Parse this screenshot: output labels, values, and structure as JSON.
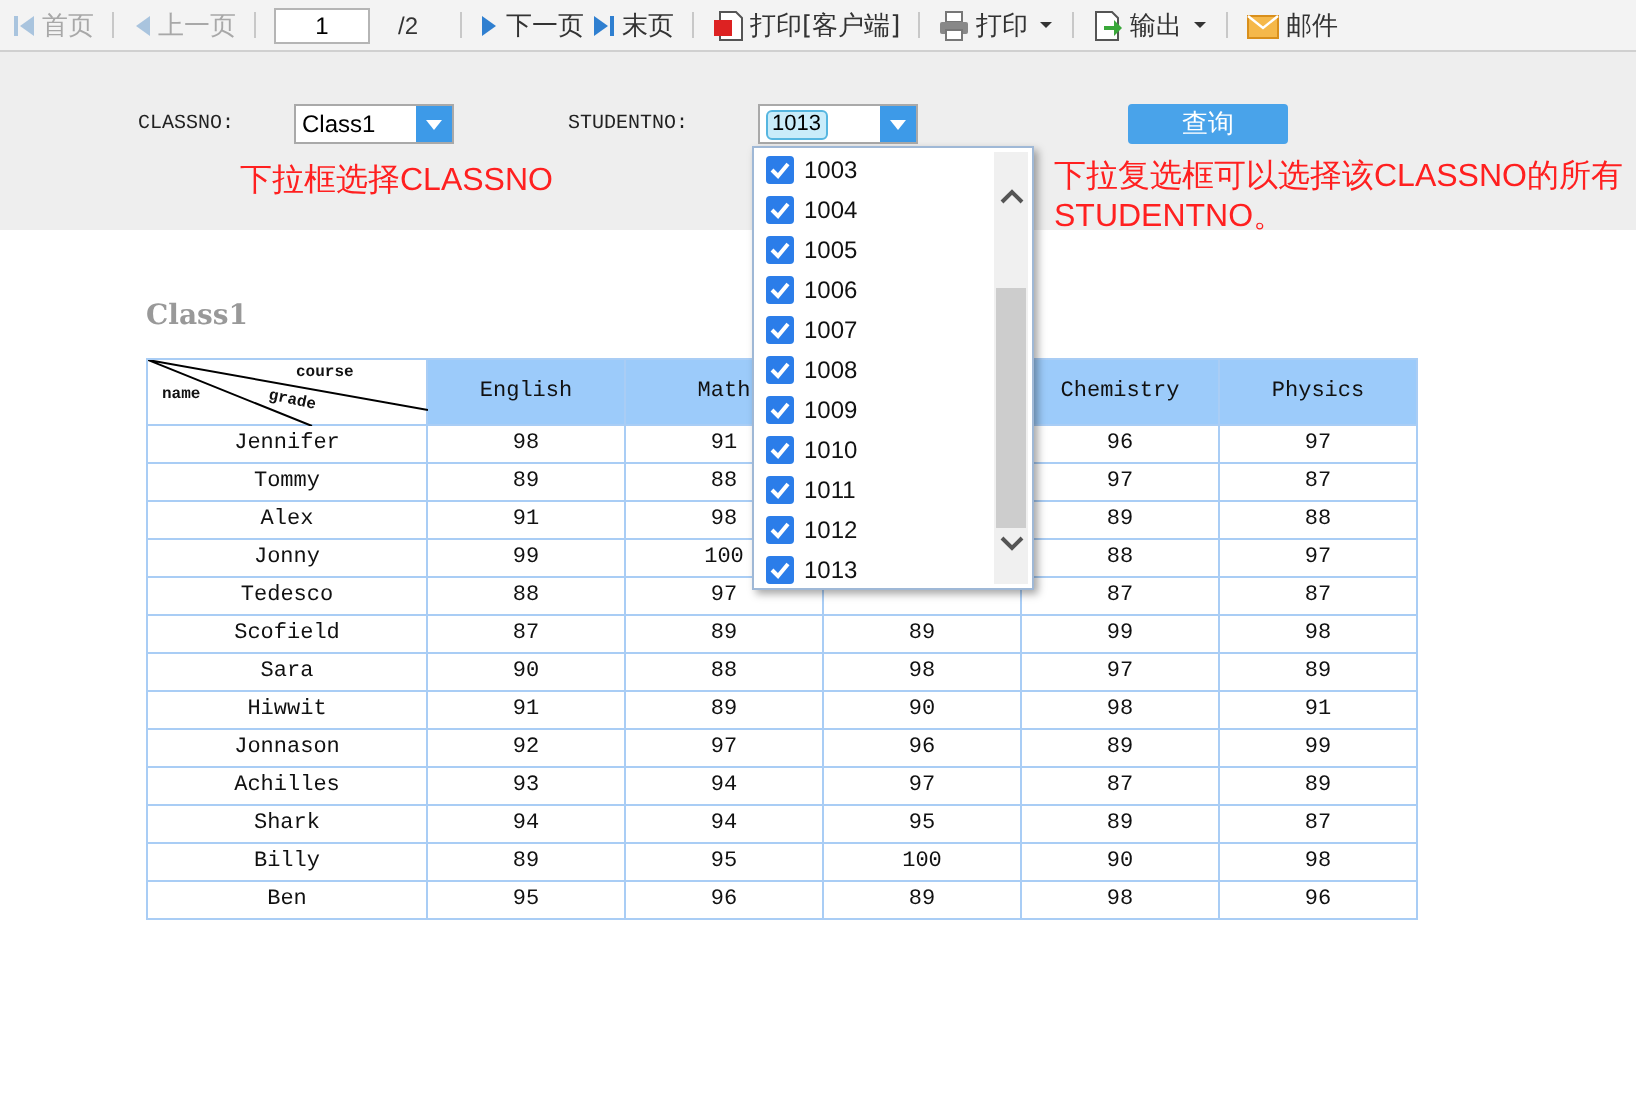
{
  "toolbar": {
    "items": [
      {
        "kind": "first",
        "label": "首页",
        "disabled": true
      },
      {
        "kind": "prev",
        "label": "上一页",
        "disabled": true
      },
      {
        "kind": "page-input",
        "value": "1"
      },
      {
        "kind": "page-count",
        "label": "/2"
      },
      {
        "kind": "next",
        "label": "下一页",
        "disabled": false
      },
      {
        "kind": "last",
        "label": "末页",
        "disabled": false
      },
      {
        "kind": "print-client",
        "label": "打印[客户端]",
        "disabled": false
      },
      {
        "kind": "print",
        "label": "打印",
        "disabled": false,
        "has_menu": true
      },
      {
        "kind": "export",
        "label": "输出",
        "disabled": false,
        "has_menu": true
      },
      {
        "kind": "mail",
        "label": "邮件",
        "disabled": false
      }
    ]
  },
  "filters": {
    "classno": {
      "label": "CLASSNO:",
      "value": "Class1"
    },
    "studentno": {
      "label": "STUDENTNO:",
      "tags": [
        "1013"
      ]
    },
    "query_button": "查询"
  },
  "notes": [
    "下拉框选择CLASSNO",
    "下拉复选框可以选择该CLASSNO的所有STUDENTNO。"
  ],
  "student_dropdown": {
    "options": [
      {
        "label": "1003",
        "checked": true
      },
      {
        "label": "1004",
        "checked": true
      },
      {
        "label": "1005",
        "checked": true
      },
      {
        "label": "1006",
        "checked": true
      },
      {
        "label": "1007",
        "checked": true
      },
      {
        "label": "1008",
        "checked": true
      },
      {
        "label": "1009",
        "checked": true
      },
      {
        "label": "1010",
        "checked": true
      },
      {
        "label": "1011",
        "checked": true
      },
      {
        "label": "1012",
        "checked": true
      },
      {
        "label": "1013",
        "checked": true
      }
    ]
  },
  "report": {
    "title": "Class1",
    "corner": {
      "top": "course",
      "middle": "grade",
      "left": "name"
    },
    "columns": {
      "english": "English",
      "math": "Math",
      "chemistry": "Chemistry",
      "physics": "Physics"
    },
    "rows": [
      {
        "name": "Jennifer",
        "english": "98",
        "math": "91",
        "chemistry": "96",
        "physics": "97"
      },
      {
        "name": "Tommy",
        "english": "89",
        "math": "88",
        "chemistry": "97",
        "physics": "87"
      },
      {
        "name": "Alex",
        "english": "91",
        "math": "98",
        "chemistry": "89",
        "physics": "88"
      },
      {
        "name": "Jonny",
        "english": "99",
        "math": "100",
        "chemistry": "88",
        "physics": "97"
      },
      {
        "name": "Tedesco",
        "english": "88",
        "math": "97",
        "chemistry": "87",
        "physics": "87"
      },
      {
        "name": "Scofield",
        "english": "87",
        "math": "89",
        "column_3": "89",
        "chemistry": "99",
        "physics": "98"
      },
      {
        "name": "Sara",
        "english": "90",
        "math": "88",
        "column_3": "98",
        "chemistry": "97",
        "physics": "89"
      },
      {
        "name": "Hiwwit",
        "english": "91",
        "math": "89",
        "column_3": "90",
        "chemistry": "98",
        "physics": "91"
      },
      {
        "name": "Jonnason",
        "english": "92",
        "math": "97",
        "column_3": "96",
        "chemistry": "89",
        "physics": "99"
      },
      {
        "name": "Achilles",
        "english": "93",
        "math": "94",
        "column_3": "97",
        "chemistry": "87",
        "physics": "89"
      },
      {
        "name": "Shark",
        "english": "94",
        "math": "94",
        "column_3": "95",
        "chemistry": "89",
        "physics": "87"
      },
      {
        "name": "Billy",
        "english": "89",
        "math": "95",
        "column_3": "100",
        "chemistry": "90",
        "physics": "98"
      },
      {
        "name": "Ben",
        "english": "95",
        "math": "96",
        "column_3": "89",
        "chemistry": "98",
        "physics": "96"
      }
    ]
  }
}
